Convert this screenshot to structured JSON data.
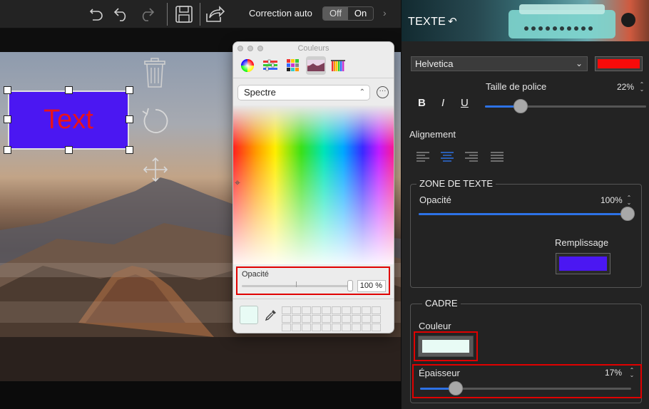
{
  "toolbar": {
    "icons": [
      "undo-history-icon",
      "undo-icon",
      "redo-icon",
      "save-icon",
      "share-icon"
    ],
    "autocorrect_label": "Correction auto",
    "toggle": {
      "off": "Off",
      "on": "On",
      "selected": "Off"
    }
  },
  "canvas": {
    "text_box": {
      "text": "Text",
      "fill_color": "#4b17f2",
      "text_color": "#e8121b"
    }
  },
  "colors_window": {
    "title": "Couleurs",
    "tabs": [
      "color-wheel",
      "color-sliders",
      "color-palettes",
      "image-palettes",
      "crayons"
    ],
    "active_tab": "image-palettes",
    "mode": "Spectre",
    "opacity_label": "Opacité",
    "opacity_value": "100 %",
    "opacity_fraction": 1.0,
    "current_color": "#e8fbf5"
  },
  "panel": {
    "header_title": "TEXTE",
    "font": "Helvetica",
    "font_color": "#f70b0a",
    "font_size_label": "Taille de police",
    "font_size_value": "22%",
    "font_size_fraction": 0.22,
    "format_buttons": {
      "bold": "B",
      "italic": "I",
      "underline": "U"
    },
    "alignment_label": "Alignement",
    "alignment_selected": "center",
    "text_zone": {
      "title": "ZONE DE TEXTE",
      "opacity_label": "Opacité",
      "opacity_value": "100%",
      "opacity_fraction": 1.0,
      "fill_label": "Remplissage",
      "fill_color": "#4b17f2"
    },
    "frame": {
      "title": "CADRE",
      "color_label": "Couleur",
      "color": "#e8fbf5",
      "thickness_label": "Épaisseur",
      "thickness_value": "17%",
      "thickness_fraction": 0.17
    }
  },
  "accent_color": "#2d72e6",
  "highlight_color": "#e00000"
}
